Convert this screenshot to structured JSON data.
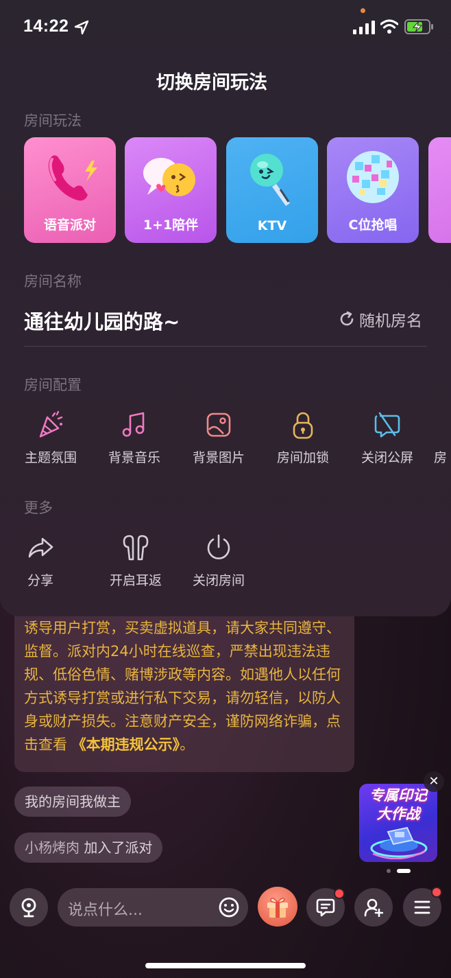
{
  "status_bar": {
    "time": "14:22"
  },
  "panel": {
    "title": "切换房间玩法",
    "modes_label": "房间玩法",
    "modes": [
      {
        "label": "语音派对",
        "icon": "phone-icon",
        "color": "#f06dbb"
      },
      {
        "label": "1+1陪伴",
        "icon": "chat-bubbles-icon",
        "color": "#c468f0"
      },
      {
        "label": "KTV",
        "icon": "microphone-icon",
        "color": "#47b6f0"
      },
      {
        "label": "C位抢唱",
        "icon": "disco-ball-icon",
        "color": "#8e6cf2"
      }
    ],
    "name_label": "房间名称",
    "room_name": "通往幼儿园的路~",
    "random_name_label": "随机房名",
    "config_label": "房间配置",
    "config_items": [
      {
        "label": "主题氛围",
        "icon": "party-popper-icon"
      },
      {
        "label": "背景音乐",
        "icon": "music-note-icon"
      },
      {
        "label": "背景图片",
        "icon": "image-icon"
      },
      {
        "label": "房间加锁",
        "icon": "lock-icon"
      },
      {
        "label": "关闭公屏",
        "icon": "chat-off-icon"
      },
      {
        "label": "房",
        "icon": ""
      }
    ],
    "more_label": "更多",
    "more_items": [
      {
        "label": "分享",
        "icon": "share-icon"
      },
      {
        "label": "开启耳返",
        "icon": "earphones-icon"
      },
      {
        "label": "关闭房间",
        "icon": "power-icon"
      }
    ]
  },
  "chat": {
    "notice_text": "诱导用户打赏，买卖虚拟道具，请大家共同遵守、监督。派对内24小时在线巡查，严禁出现违法违规、低俗色情、赌博涉政等内容。如遇他人以任何方式诱导打赏或进行私下交易，请勿轻信，以防人身或财产损失。注意财产安全，谨防网络诈骗，点击查看",
    "notice_link": "《本期违规公示》",
    "notice_end": "。",
    "messages": [
      {
        "text": "我的房间我做主"
      },
      {
        "user": "小杨烤肉",
        "action": "加入了派对"
      }
    ]
  },
  "promo": {
    "title_line1": "专属印记",
    "title_line2": "大作战"
  },
  "input": {
    "placeholder": "说点什么..."
  },
  "colors": {
    "notice_text": "#e9b53f",
    "badge": "#ff4d4f"
  }
}
